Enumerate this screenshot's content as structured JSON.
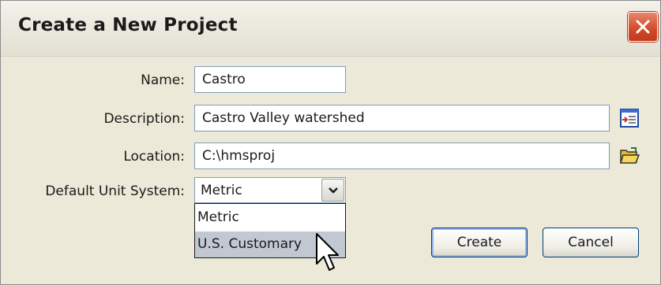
{
  "dialog": {
    "title": "Create a New Project"
  },
  "form": {
    "name_label": "Name:",
    "name_value": "Castro",
    "description_label": "Description:",
    "description_value": "Castro Valley watershed",
    "location_label": "Location:",
    "location_value": "C:\\hmsproj",
    "unit_label": "Default Unit System:",
    "unit_selected": "Metric",
    "unit_options": [
      "Metric",
      "U.S. Customary"
    ]
  },
  "buttons": {
    "create_label": "Create",
    "cancel_label": "Cancel"
  },
  "icons": {
    "close": "close-icon",
    "description_browse": "document-edit-icon",
    "location_browse": "folder-open-icon",
    "dropdown_arrow": "chevron-down-icon",
    "cursor": "mouse-pointer-icon"
  },
  "colors": {
    "dialog_background": "#ece9d8",
    "close_button": "#d2492a",
    "field_border": "#7f9db9",
    "selection_highlight": "#c2c8d2",
    "button_border": "#003c74"
  }
}
